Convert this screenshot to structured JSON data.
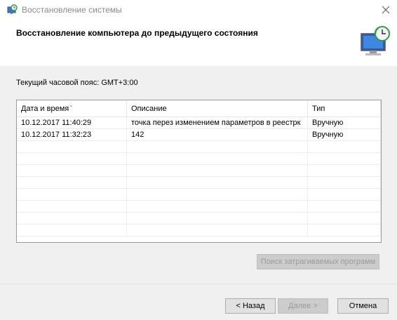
{
  "window": {
    "title": "Восстановление системы",
    "icon": "system-restore-icon",
    "close_icon": "close-icon"
  },
  "header": {
    "title": "Восстановление компьютера до предыдущего состояния",
    "icon": "system-restore-monitor-icon"
  },
  "timezone_label": "Текущий часовой пояс: GMT+3:00",
  "table": {
    "columns": [
      "Дата и время",
      "Описание",
      "Тип"
    ],
    "sorted_column": "Дата и время",
    "rows": [
      {
        "date": "10.12.2017 11:40:29",
        "description": "точка перез изменением параметров в реестрк",
        "type": "Вручную"
      },
      {
        "date": "10.12.2017 11:32:23",
        "description": "142",
        "type": "Вручную"
      }
    ]
  },
  "buttons": {
    "scan": "Поиск затрагиваемых программ",
    "back": "< Назад",
    "next": "Далее >",
    "cancel": "Отмена"
  },
  "colors": {
    "panel_bg": "#f0f0f0",
    "disabled_text": "#9a9a9a"
  }
}
